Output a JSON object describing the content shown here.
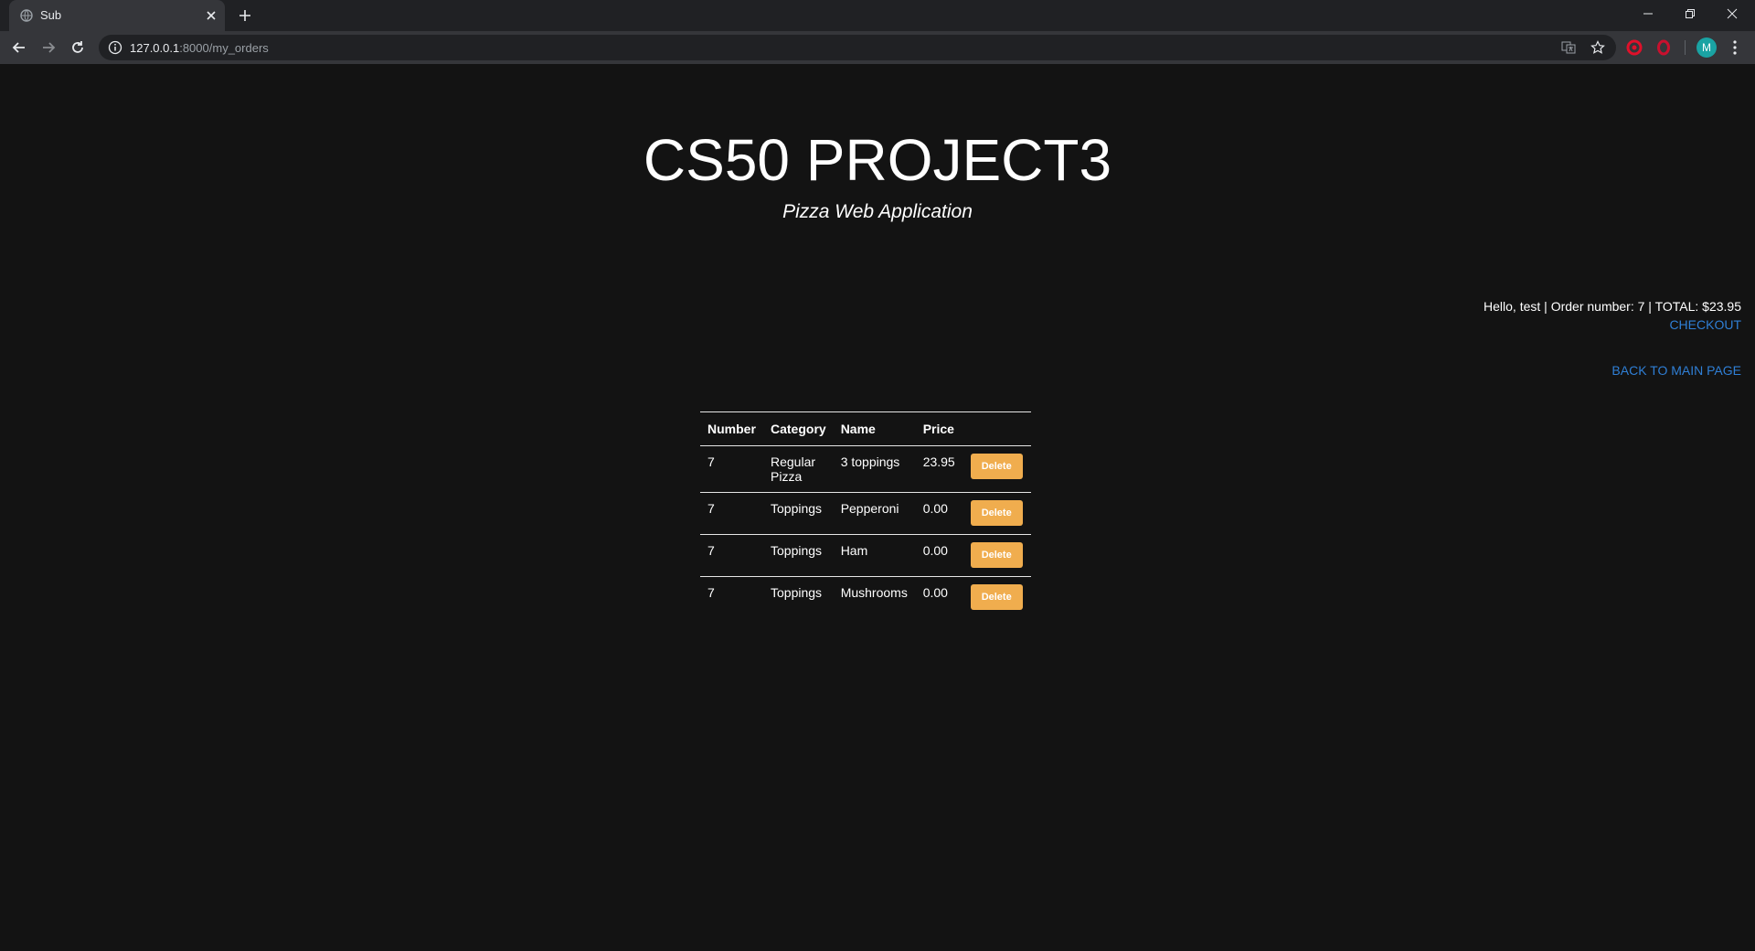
{
  "browser": {
    "tab_title": "Sub",
    "url_host": "127.0.0.1",
    "url_path": ":8000/my_orders",
    "profile_initial": "M"
  },
  "header": {
    "title": "CS50 PROJECT3",
    "subtitle": "Pizza Web Application"
  },
  "user_bar": {
    "info": "Hello, test | Order number: 7 | TOTAL: $23.95",
    "checkout_label": "CHECKOUT",
    "back_label": "BACK TO MAIN PAGE"
  },
  "orders_table": {
    "columns": [
      "Number",
      "Category",
      "Name",
      "Price"
    ],
    "delete_label": "Delete",
    "rows": [
      {
        "number": "7",
        "category": "Regular Pizza",
        "name": "3 toppings",
        "price": "23.95"
      },
      {
        "number": "7",
        "category": "Toppings",
        "name": "Pepperoni",
        "price": "0.00"
      },
      {
        "number": "7",
        "category": "Toppings",
        "name": "Ham",
        "price": "0.00"
      },
      {
        "number": "7",
        "category": "Toppings",
        "name": "Mushrooms",
        "price": "0.00"
      }
    ]
  },
  "colors": {
    "page_bg": "#131313",
    "link": "#2f7fd6",
    "delete_button": "#f0ad4e"
  }
}
